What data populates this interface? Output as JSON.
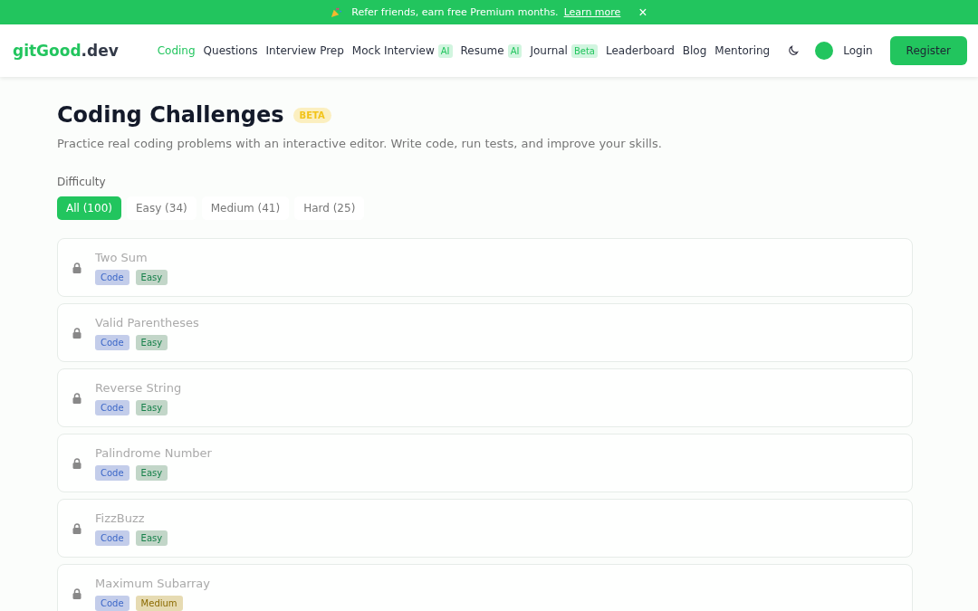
{
  "banner": {
    "text": "Refer friends, earn free Premium months.",
    "link": "Learn more",
    "close": "×"
  },
  "header": {
    "logo": {
      "main": "gitGood",
      "suffix": ".dev"
    },
    "nav": [
      {
        "label": "Coding",
        "selected": true
      },
      {
        "label": "Questions",
        "selected": false
      },
      {
        "label": "Interview Prep",
        "selected": false
      },
      {
        "label": "Mock Interview",
        "badge": "AI",
        "selected": false
      },
      {
        "label": "Resume",
        "badge": "AI",
        "selected": false
      },
      {
        "label": "Journal",
        "badge": "Beta",
        "selected": false
      },
      {
        "label": "Leaderboard",
        "selected": false
      },
      {
        "label": "Blog",
        "selected": false
      },
      {
        "label": "Mentoring",
        "selected": false
      }
    ],
    "login": "Login",
    "register": "Register"
  },
  "page": {
    "title": "Coding Challenges",
    "badge": "BETA",
    "subtitle": "Practice real coding problems with an interactive editor. Write code, run tests, and improve your skills.",
    "filter_label": "Difficulty",
    "filters": [
      {
        "label": "All (100)",
        "selected": true
      },
      {
        "label": "Easy (34)",
        "selected": false
      },
      {
        "label": "Medium (41)",
        "selected": false
      },
      {
        "label": "Hard (25)",
        "selected": false
      }
    ]
  },
  "problems": [
    {
      "title": "Two Sum",
      "locked": true,
      "type_tag": "Code",
      "difficulty": {
        "kind": "easy",
        "label": "Easy"
      }
    },
    {
      "title": "Valid Parentheses",
      "locked": true,
      "type_tag": "Code",
      "difficulty": {
        "kind": "easy",
        "label": "Easy"
      }
    },
    {
      "title": "Reverse String",
      "locked": true,
      "type_tag": "Code",
      "difficulty": {
        "kind": "easy",
        "label": "Easy"
      }
    },
    {
      "title": "Palindrome Number",
      "locked": true,
      "type_tag": "Code",
      "difficulty": {
        "kind": "easy",
        "label": "Easy"
      }
    },
    {
      "title": "FizzBuzz",
      "locked": true,
      "type_tag": "Code",
      "difficulty": {
        "kind": "easy",
        "label": "Easy"
      }
    },
    {
      "title": "Maximum Subarray",
      "locked": true,
      "type_tag": "Code",
      "difficulty": {
        "kind": "medium",
        "label": "Medium"
      }
    }
  ]
}
